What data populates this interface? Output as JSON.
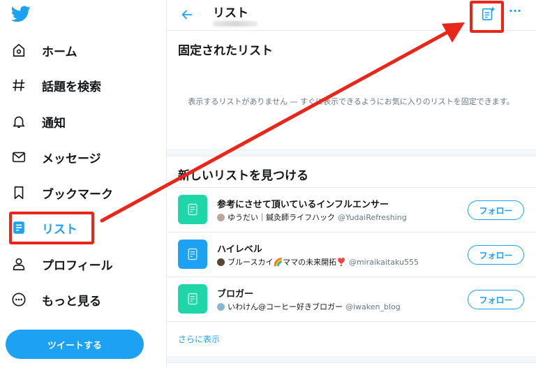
{
  "sidebar": {
    "logo": "bird-icon",
    "items": [
      {
        "label": "ホーム",
        "icon": "home-icon"
      },
      {
        "label": "話題を検索",
        "icon": "hashtag-icon"
      },
      {
        "label": "通知",
        "icon": "bell-icon"
      },
      {
        "label": "メッセージ",
        "icon": "envelope-icon"
      },
      {
        "label": "ブックマーク",
        "icon": "bookmark-icon"
      },
      {
        "label": "リスト",
        "icon": "list-icon"
      },
      {
        "label": "プロフィール",
        "icon": "person-icon"
      },
      {
        "label": "もっと見る",
        "icon": "more-circle-icon"
      }
    ],
    "tweet_button": "ツイートする"
  },
  "header": {
    "title": "リスト",
    "back_icon": "back-arrow-icon",
    "new_list_icon": "new-list-icon",
    "more_icon": "···"
  },
  "pinned": {
    "title": "固定されたリスト",
    "empty_message": "表示するリストがありません — すぐに表示できるようにお気に入りのリストを固定できます。"
  },
  "discover": {
    "title": "新しいリストを見つける",
    "lists": [
      {
        "name": "参考にさせて頂いているインフルエンサー",
        "owner": "ゆうだい｜鍼灸師ライフハック",
        "handle": "@YudaiRefreshing",
        "thumb_color": "#1ed6a8",
        "follow": "フォロー"
      },
      {
        "name": "ハイレベル",
        "owner": "ブルースカイ🌈ママの未来開拓❣️",
        "handle": "@miraikaitaku555",
        "thumb_color": "#1da1f2",
        "follow": "フォロー"
      },
      {
        "name": "ブロガー",
        "owner": "いわけん@コーヒー好きブロガー",
        "handle": "@iwaken_blog",
        "thumb_color": "#1ed6a8",
        "follow": "フォロー"
      }
    ],
    "show_more": "さらに表示"
  },
  "colors": {
    "accent": "#1da1f2",
    "annotation": "#e8261a",
    "teal": "#1ed6a8"
  }
}
